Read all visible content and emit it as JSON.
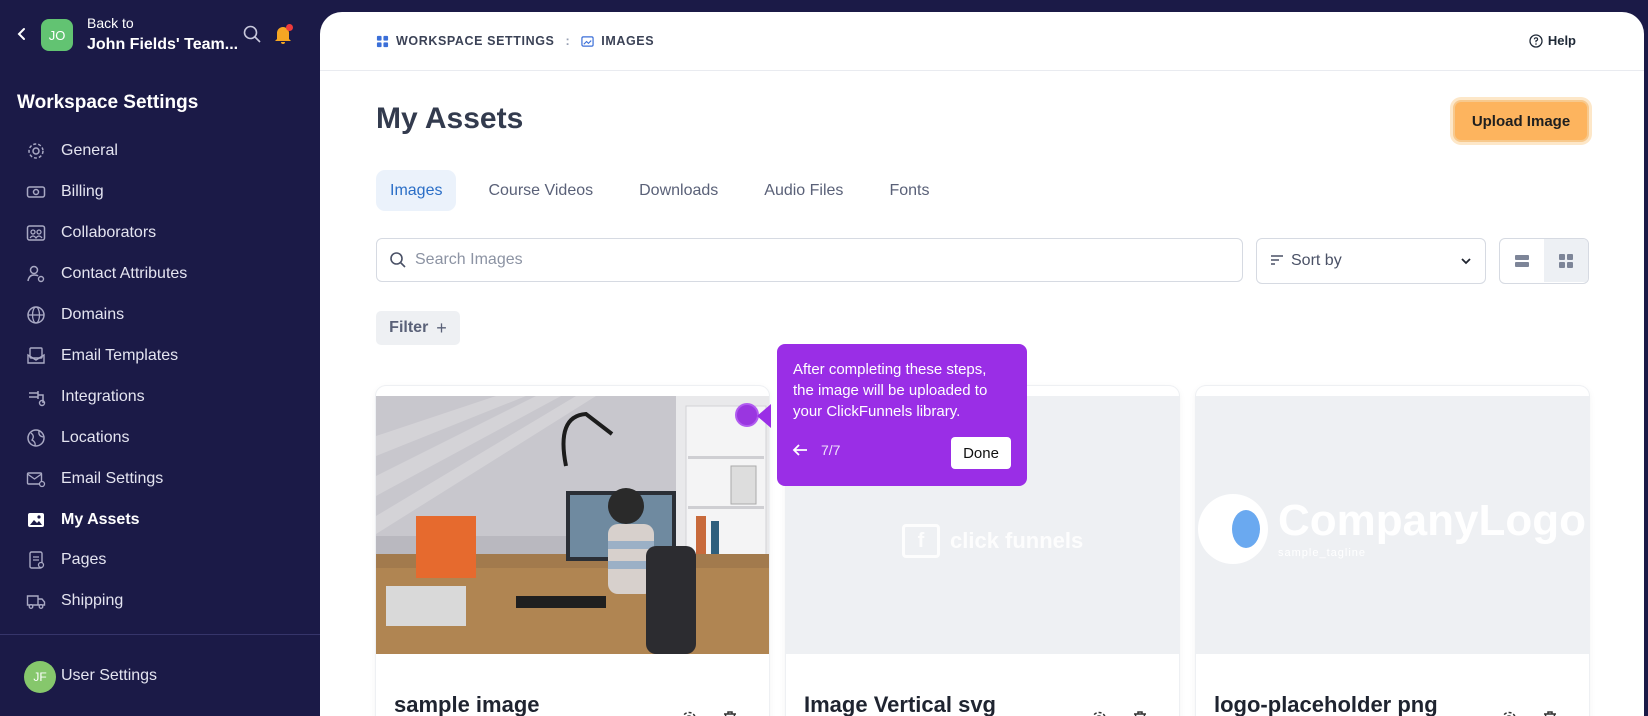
{
  "sidebar": {
    "back_label": "Back to",
    "team_name": "John Fields' Team...",
    "workspace_initials": "JO",
    "heading": "Workspace Settings",
    "items": [
      {
        "label": "General",
        "icon": "gear-icon"
      },
      {
        "label": "Billing",
        "icon": "banknote-icon"
      },
      {
        "label": "Collaborators",
        "icon": "users-icon"
      },
      {
        "label": "Contact Attributes",
        "icon": "user-settings-icon"
      },
      {
        "label": "Domains",
        "icon": "globe-icon"
      },
      {
        "label": "Email Templates",
        "icon": "mail-template-icon"
      },
      {
        "label": "Integrations",
        "icon": "plug-icon"
      },
      {
        "label": "Locations",
        "icon": "world-icon"
      },
      {
        "label": "Email Settings",
        "icon": "mail-settings-icon"
      },
      {
        "label": "My Assets",
        "icon": "image-icon",
        "active": true
      },
      {
        "label": "Pages",
        "icon": "pages-icon"
      },
      {
        "label": "Shipping",
        "icon": "truck-icon"
      }
    ],
    "user_initials": "JF",
    "user_settings_label": "User Settings"
  },
  "header": {
    "breadcrumb": [
      "WORKSPACE SETTINGS",
      "IMAGES"
    ],
    "help_label": "Help"
  },
  "main": {
    "title": "My Assets",
    "upload_label": "Upload Image",
    "tabs": [
      {
        "label": "Images",
        "active": true
      },
      {
        "label": "Course Videos"
      },
      {
        "label": "Downloads"
      },
      {
        "label": "Audio Files"
      },
      {
        "label": "Fonts"
      }
    ],
    "search": {
      "placeholder": "Search Images",
      "value": ""
    },
    "sort_label": "Sort by",
    "filter_label": "Filter",
    "assets": [
      {
        "name": "sample image"
      },
      {
        "name": "Image Vertical svg",
        "logo_text": "click funnels"
      },
      {
        "name": "logo-placeholder png",
        "logo_text": "CompanyLogo",
        "logo_sub": "sample_tagline"
      }
    ]
  },
  "tooltip": {
    "text": "After completing these steps, the image will be uploaded to your ClickFunnels library.",
    "step": "7/7",
    "done_label": "Done"
  },
  "colors": {
    "sidebar_bg": "#1b1a47",
    "accent_blue": "#2a6ec6",
    "upload_orange": "#fdb45e",
    "tooltip_purple": "#9a2ee6",
    "avatar_green": "#62c372"
  }
}
